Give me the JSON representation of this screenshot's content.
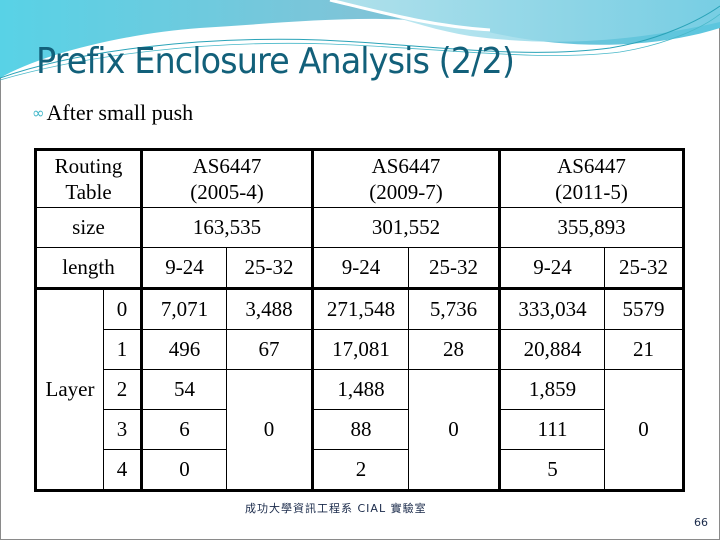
{
  "slide": {
    "title": "Prefix Enclosure Analysis (2/2)",
    "bullet": "After small push",
    "bullet_icon": "swirl-bullet-icon",
    "footer": "成功大學資訊工程系  CIAL 實驗室",
    "page_number": "66",
    "colors": {
      "title": "#12607a",
      "bullet_icon": "#3fb6c8",
      "header_wave": "#5ec8dc"
    }
  },
  "table": {
    "header_label": "Routing Table",
    "header_label_lines": [
      "Routing",
      "Table"
    ],
    "size_label": "size",
    "length_label": "length",
    "layer_label": "Layer",
    "datasets": [
      {
        "name": "AS6447",
        "date": "(2005-4)",
        "size": "163,535"
      },
      {
        "name": "AS6447",
        "date": "(2009-7)",
        "size": "301,552"
      },
      {
        "name": "AS6447",
        "date": "(2011-5)",
        "size": "355,893"
      }
    ],
    "length_ranges": [
      "9-24",
      "25-32"
    ],
    "layers": [
      {
        "layer": "0",
        "values": [
          "7,071",
          "3,488",
          "271,548",
          "5,736",
          "333,034",
          "5579"
        ]
      },
      {
        "layer": "1",
        "values": [
          "496",
          "67",
          "17,081",
          "28",
          "20,884",
          "21"
        ]
      },
      {
        "layer": "2",
        "values": [
          "54",
          "",
          "1,488",
          "",
          "1,859",
          ""
        ]
      },
      {
        "layer": "3",
        "values": [
          "6",
          "",
          "88",
          "",
          "111",
          ""
        ]
      },
      {
        "layer": "4",
        "values": [
          "0",
          "",
          "2",
          "",
          "5",
          ""
        ]
      }
    ],
    "merged_25_32_layers_2_to_4": [
      "0",
      "0",
      "0"
    ]
  }
}
